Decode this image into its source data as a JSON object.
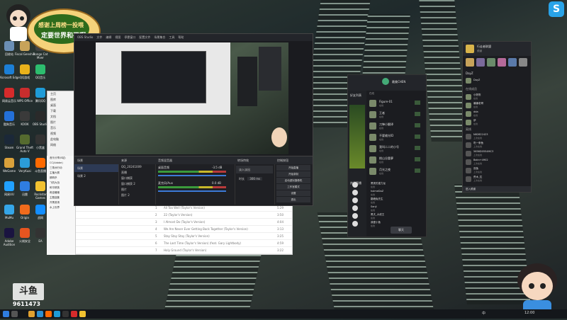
{
  "stream_banner": {
    "line1": "感谢上周榜一投喂",
    "line2": "定要世界和平啊"
  },
  "overlay": {
    "platform": "斗鱼",
    "room_id": "9611473"
  },
  "desktop_icons": [
    {
      "label": "回收站",
      "color": "#6b8fb5"
    },
    {
      "label": "Fiscal Genshin",
      "color": "#c7a35a"
    },
    {
      "label": "Bongo Cat Mver",
      "color": "#444"
    },
    {
      "label": "Microsoft Edge",
      "color": "#1c7fd6"
    },
    {
      "label": "QQ游戏",
      "color": "#e9b21b"
    },
    {
      "label": "QQ音乐",
      "color": "#2dbd6e"
    },
    {
      "label": "网易云音乐",
      "color": "#d62b2b"
    },
    {
      "label": "WPS Office",
      "color": "#c92d2d"
    },
    {
      "label": "腾讯QQ",
      "color": "#1e9bd7"
    },
    {
      "label": "酷狗音乐",
      "color": "#2370d8"
    },
    {
      "label": "KOOK",
      "color": "#3a3a3a"
    },
    {
      "label": "OBS Studio",
      "color": "#2a2a2a"
    },
    {
      "label": "Steam",
      "color": "#1b2838"
    },
    {
      "label": "Grand Theft Auto V",
      "color": "#556b2f"
    },
    {
      "label": "小黑盒",
      "color": "#333"
    },
    {
      "label": "WeGame",
      "color": "#d9a13b"
    },
    {
      "label": "VeryKuai",
      "color": "#2b9cd8"
    },
    {
      "label": "斗鱼直播",
      "color": "#ff6a00"
    },
    {
      "label": "网易UU",
      "color": "#20a0ff"
    },
    {
      "label": "迅雷",
      "color": "#2f7de1"
    },
    {
      "label": "Rockstar Games",
      "color": "#f2c230"
    },
    {
      "label": "MuMu",
      "color": "#35a6e8"
    },
    {
      "label": "Origin",
      "color": "#f06b1c"
    },
    {
      "label": "战网",
      "color": "#148eff"
    },
    {
      "label": "Adobe Audition",
      "color": "#1a1440"
    },
    {
      "label": "火绒安全",
      "color": "#e65520"
    },
    {
      "label": "EA",
      "color": "#333"
    }
  ],
  "file_explorer": {
    "nav": [
      "主页",
      "图库",
      "桌面",
      "下载",
      "文档",
      "图片",
      "音乐",
      "视频",
      "此电脑",
      "网络"
    ],
    "left_items": [
      "音乐分享(B站)",
      "CC(Adobe)",
      "三角洲行动",
      "主播大赛",
      "鹅鸭杀",
      "飞机大战",
      "和平精英",
      "奇迹暖暖",
      "主题曲集",
      "开黑邀请",
      "水上世界"
    ]
  },
  "music_list": {
    "rows": [
      {
        "num": "1",
        "title": "All Too Well (Taylor's Version)",
        "time": "5:29"
      },
      {
        "num": "2",
        "title": "22 (Taylor's Version)",
        "time": "3:50"
      },
      {
        "num": "3",
        "title": "I Almost Do (Taylor's Version)",
        "time": "4:04"
      },
      {
        "num": "4",
        "title": "We Are Never Ever Getting Back Together (Taylor's Version)",
        "time": "3:13"
      },
      {
        "num": "5",
        "title": "Stay Stay Stay (Taylor's Version)",
        "time": "3:25"
      },
      {
        "num": "6",
        "title": "The Last Time (Taylor's Version) (feat. Gary Lightbody)",
        "time": "4:59"
      },
      {
        "num": "7",
        "title": "Holy Ground (Taylor's Version)",
        "time": "3:22"
      }
    ]
  },
  "obs": {
    "title": "OBS Studio",
    "menus": [
      "文件",
      "编辑",
      "视图",
      "停靠窗口",
      "配置文件",
      "场景集合",
      "工具",
      "帮助"
    ],
    "scenes_header": "场景",
    "scenes": [
      "场景",
      "场景 2"
    ],
    "sources_header": "来源",
    "sources": [
      "QQ_20241009",
      "直播",
      "窗口捕获",
      "窗口捕获 2",
      "图片",
      "图片 2"
    ],
    "mixer_header": "音频混音器",
    "mixer": [
      {
        "name": "桌面音频",
        "db": "-3.5 dB"
      },
      {
        "name": "麦克风/Aux",
        "db": "0.0 dB"
      }
    ],
    "transition_header": "转场特效",
    "transition_value": "淡入淡出",
    "duration_label": "时长",
    "duration_value": "300 ms",
    "controls_header": "控制按钮",
    "controls": [
      "开始直播",
      "开始录制",
      "启动虚拟摄像机",
      "工作室模式",
      "设置",
      "退出"
    ]
  },
  "discord_like": {
    "server_name": "最美CHEN",
    "friends_header": "好友列表",
    "online_label": "在线",
    "friends": [
      {
        "name": "Figure-01",
        "status": "在线"
      },
      {
        "name": "王者",
        "status": "在线"
      },
      {
        "name": "刀锋小翻译",
        "status": "在线"
      },
      {
        "name": "不要输光ID",
        "status": "在线"
      },
      {
        "name": "我叫二二的小号",
        "status": "在线"
      },
      {
        "name": "桃山谷重夢",
        "status": "在线"
      },
      {
        "name": "月光之夜",
        "status": "在线"
      }
    ],
    "section2": "热门直播",
    "friends2": [
      {
        "name": "黑夜的重力龙",
        "status": "在线"
      },
      {
        "name": "holmeDoZ",
        "status": "在线"
      },
      {
        "name": "翻墙兔先生",
        "status": "在线"
      },
      {
        "name": "Sanji",
        "status": "在线"
      },
      {
        "name": "黑夫_大佬王",
        "status": "在线"
      },
      {
        "name": "我爱小鱼",
        "status": "在线"
      }
    ],
    "bottom_button": "聊天"
  },
  "right_chat": {
    "title": "行走者联盟",
    "subtitle": "频道",
    "channel_top": "DayZ",
    "channel_top_user": "DayZ",
    "members_header": "在线成员",
    "members": [
      {
        "name": "小陈陈",
        "status": "在线"
      },
      {
        "name": "暴躁老哥",
        "status": "在线"
      },
      {
        "name": "dda",
        "status": "在线"
      },
      {
        "name": "伊",
        "status": "在线"
      }
    ],
    "offline_header": "离线",
    "offline": [
      {
        "name": "N82822423",
        "status": "上次在线"
      },
      {
        "name": "吃一条鱼",
        "status": "上次在线"
      },
      {
        "name": "5656D0554MC3",
        "status": "上次在线"
      },
      {
        "name": "Bakn+4902",
        "status": "上次在线"
      },
      {
        "name": "双鱼",
        "status": "上次在线"
      },
      {
        "name": "荒木_拉",
        "status": "上次在线"
      }
    ],
    "footer": "进入频道"
  },
  "taskbar": {
    "clock": "12:00",
    "tray_label": "中"
  }
}
